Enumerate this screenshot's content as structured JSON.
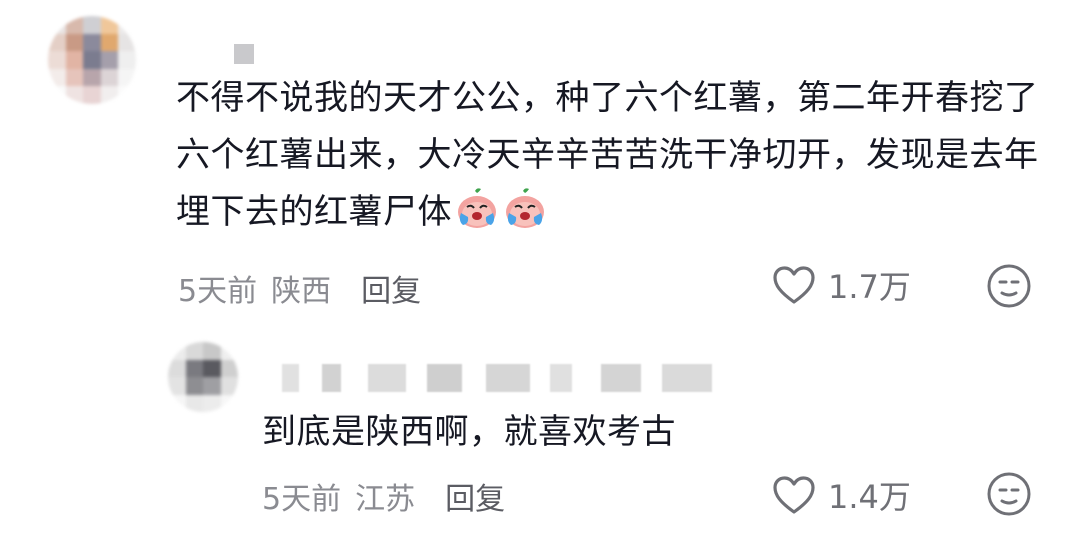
{
  "comment": {
    "text": "不得不说我的天才公公，种了六个红薯，第二年开春挖了六个红薯出来，大冷天辛辛苦苦洗干净切开，发现是去年埋下去的红薯尸体",
    "emoji_icon": "crying-sweet-potato-emoji",
    "emoji_count": 2,
    "time": "5天前",
    "location": "陕西",
    "reply_label": "回复",
    "likes": "1.7万"
  },
  "reply": {
    "text": "到底是陕西啊，就喜欢考古",
    "time": "5天前",
    "location": "江苏",
    "reply_label": "回复",
    "likes": "1.4万"
  },
  "icons": {
    "like": "heart-outline-icon",
    "react": "smiley-face-icon"
  },
  "colors": {
    "text": "#161823",
    "meta": "#8a8b91",
    "icon": "#6f7076"
  }
}
